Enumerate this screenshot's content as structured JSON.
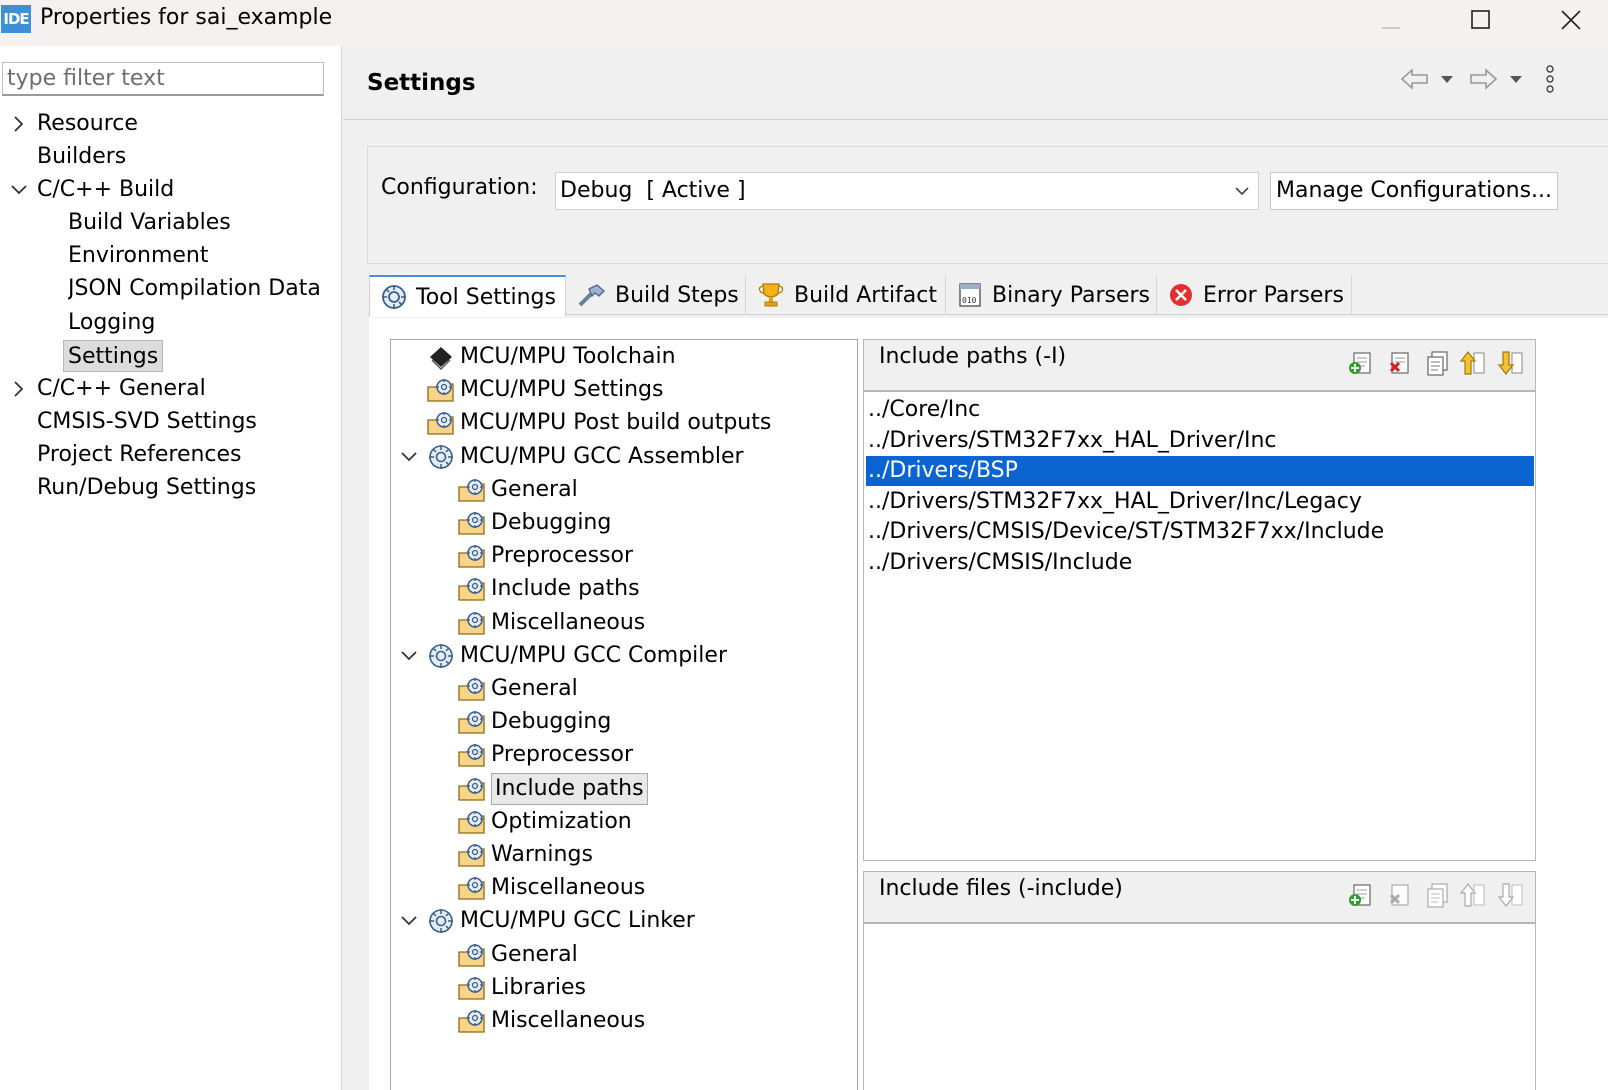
{
  "window": {
    "app_icon_text": "IDE",
    "title": "Properties for sai_example"
  },
  "filter": {
    "placeholder": "type filter text",
    "value": ""
  },
  "nav": {
    "items": [
      {
        "label": "Resource",
        "expander": "collapsed"
      },
      {
        "label": "Builders"
      },
      {
        "label": "C/C++ Build",
        "expander": "expanded"
      },
      {
        "label": "Build Variables"
      },
      {
        "label": "Environment"
      },
      {
        "label": "JSON Compilation Data"
      },
      {
        "label": "Logging"
      },
      {
        "label": "Settings",
        "selected": true
      },
      {
        "label": "C/C++ General",
        "expander": "collapsed"
      },
      {
        "label": "CMSIS-SVD Settings"
      },
      {
        "label": "Project References"
      },
      {
        "label": "Run/Debug Settings"
      }
    ]
  },
  "page": {
    "title": "Settings"
  },
  "config": {
    "label": "Configuration:",
    "selected": "Debug  [ Active ]",
    "manage_label": "Manage Configurations..."
  },
  "tabs": [
    {
      "label": "Tool Settings",
      "active": true,
      "icon": "tool-settings-icon"
    },
    {
      "label": "Build Steps",
      "icon": "build-steps-icon"
    },
    {
      "label": "Build Artifact",
      "icon": "build-artifact-icon"
    },
    {
      "label": "Binary Parsers",
      "icon": "binary-parsers-icon"
    },
    {
      "label": "Error Parsers",
      "icon": "error-parsers-icon"
    }
  ],
  "tool_tree": [
    {
      "label": "MCU/MPU Toolchain",
      "level": 0,
      "icon": "chip-icon"
    },
    {
      "label": "MCU/MPU Settings",
      "level": 0,
      "icon": "options-folder-icon"
    },
    {
      "label": "MCU/MPU Post build outputs",
      "level": 0,
      "icon": "options-folder-icon"
    },
    {
      "label": "MCU/MPU GCC Assembler",
      "level": 0,
      "icon": "tool-gear-icon",
      "expander": "expanded"
    },
    {
      "label": "General",
      "level": 1,
      "icon": "options-folder-icon"
    },
    {
      "label": "Debugging",
      "level": 1,
      "icon": "options-folder-icon"
    },
    {
      "label": "Preprocessor",
      "level": 1,
      "icon": "options-folder-icon"
    },
    {
      "label": "Include paths",
      "level": 1,
      "icon": "options-folder-icon"
    },
    {
      "label": "Miscellaneous",
      "level": 1,
      "icon": "options-folder-icon"
    },
    {
      "label": "MCU/MPU GCC Compiler",
      "level": 0,
      "icon": "tool-gear-icon",
      "expander": "expanded"
    },
    {
      "label": "General",
      "level": 1,
      "icon": "options-folder-icon"
    },
    {
      "label": "Debugging",
      "level": 1,
      "icon": "options-folder-icon"
    },
    {
      "label": "Preprocessor",
      "level": 1,
      "icon": "options-folder-icon"
    },
    {
      "label": "Include paths",
      "level": 1,
      "icon": "options-folder-icon",
      "selected": true
    },
    {
      "label": "Optimization",
      "level": 1,
      "icon": "options-folder-icon"
    },
    {
      "label": "Warnings",
      "level": 1,
      "icon": "options-folder-icon"
    },
    {
      "label": "Miscellaneous",
      "level": 1,
      "icon": "options-folder-icon"
    },
    {
      "label": "MCU/MPU GCC Linker",
      "level": 0,
      "icon": "tool-gear-icon",
      "expander": "expanded"
    },
    {
      "label": "General",
      "level": 1,
      "icon": "options-folder-icon"
    },
    {
      "label": "Libraries",
      "level": 1,
      "icon": "options-folder-icon"
    },
    {
      "label": "Miscellaneous",
      "level": 1,
      "icon": "options-folder-icon"
    }
  ],
  "include_paths": {
    "title": "Include paths (-I)",
    "items": [
      "../Core/Inc",
      "../Drivers/STM32F7xx_HAL_Driver/Inc",
      "../Drivers/BSP",
      "../Drivers/STM32F7xx_HAL_Driver/Inc/Legacy",
      "../Drivers/CMSIS/Device/ST/STM32F7xx/Include",
      "../Drivers/CMSIS/Include"
    ],
    "selected_index": 2
  },
  "include_files": {
    "title": "Include files (-include)",
    "items": []
  },
  "colors": {
    "selection": "#0a64d2",
    "tab_accent": "#4a90d9",
    "add_icon_green": "#2e9e2e",
    "delete_icon_red": "#d02020"
  }
}
